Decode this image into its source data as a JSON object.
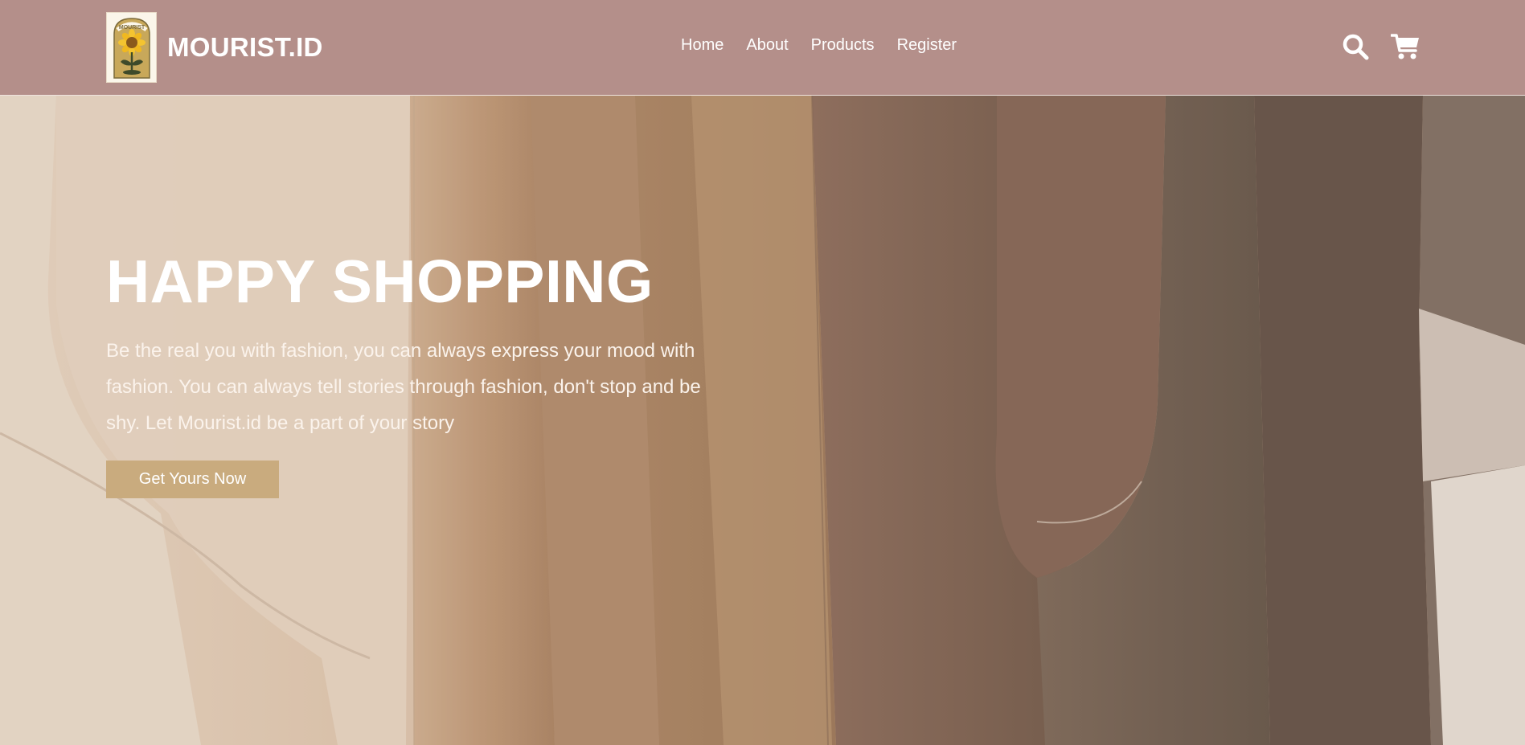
{
  "brand": {
    "name": "MOURIST.ID",
    "logo_text": "MOURIST",
    "logo_icon": "sunflower-icon"
  },
  "nav": {
    "links": [
      {
        "label": "Home"
      },
      {
        "label": "About"
      },
      {
        "label": "Products"
      },
      {
        "label": "Register"
      }
    ],
    "icons": [
      "search-icon",
      "shopping-cart-icon"
    ]
  },
  "hero": {
    "title": "HAPPY SHOPPING",
    "description": "Be the real you with fashion, you can always express your mood with fashion. You can always tell stories through fashion, don't stop and be shy. Let Mourist.id be a part of your story",
    "cta_label": "Get Yours Now"
  },
  "colors": {
    "navbar": "#b48f8a",
    "cta": "#c9ab7e",
    "text": "#ffffff"
  }
}
